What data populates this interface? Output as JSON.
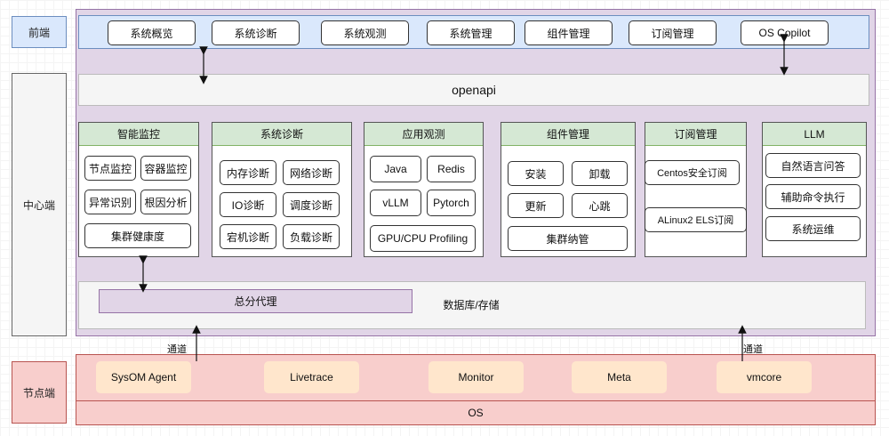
{
  "tiers": {
    "frontend": "前端",
    "center": "中心端",
    "node": "节点端"
  },
  "frontend_buttons": [
    "系统概览",
    "系统诊断",
    "系统观测",
    "系统管理",
    "组件管理",
    "订阅管理",
    "OS Copilot"
  ],
  "openapi": "openapi",
  "modules": {
    "monitor": {
      "title": "智能监控",
      "items": [
        "节点监控",
        "容器监控",
        "异常识别",
        "根因分析",
        "集群健康度"
      ]
    },
    "diagnosis": {
      "title": "系统诊断",
      "items": [
        "内存诊断",
        "网络诊断",
        "IO诊断",
        "调度诊断",
        "宕机诊断",
        "负载诊断"
      ]
    },
    "observe": {
      "title": "应用观测",
      "items": [
        "Java",
        "Redis",
        "vLLM",
        "Pytorch",
        "GPU/CPU Profiling"
      ]
    },
    "component": {
      "title": "组件管理",
      "items": [
        "安装",
        "卸载",
        "更新",
        "心跳",
        "集群纳管"
      ]
    },
    "subscribe": {
      "title": "订阅管理",
      "items": [
        "Centos安全订阅",
        "ALinux2 ELS订阅"
      ]
    },
    "llm": {
      "title": "LLM",
      "items": [
        "自然语言问答",
        "辅助命令执行",
        "系统运维"
      ]
    }
  },
  "proxy": "总分代理",
  "storage": "数据库/存储",
  "channel_left": "通道",
  "channel_right": "通道",
  "node_items": [
    "SysOM Agent",
    "Livetrace",
    "Monitor",
    "Meta",
    "vmcore"
  ],
  "os": "OS",
  "colors": {
    "frontend_fill": "#dae8fc",
    "frontend_border": "#6c8ebf",
    "center_fill": "#e1d5e7",
    "center_border": "#9673a6",
    "node_fill": "#f8cecc",
    "node_border": "#b85450",
    "panel_head": "#d5e8d4",
    "node_item": "#ffe6cc"
  }
}
